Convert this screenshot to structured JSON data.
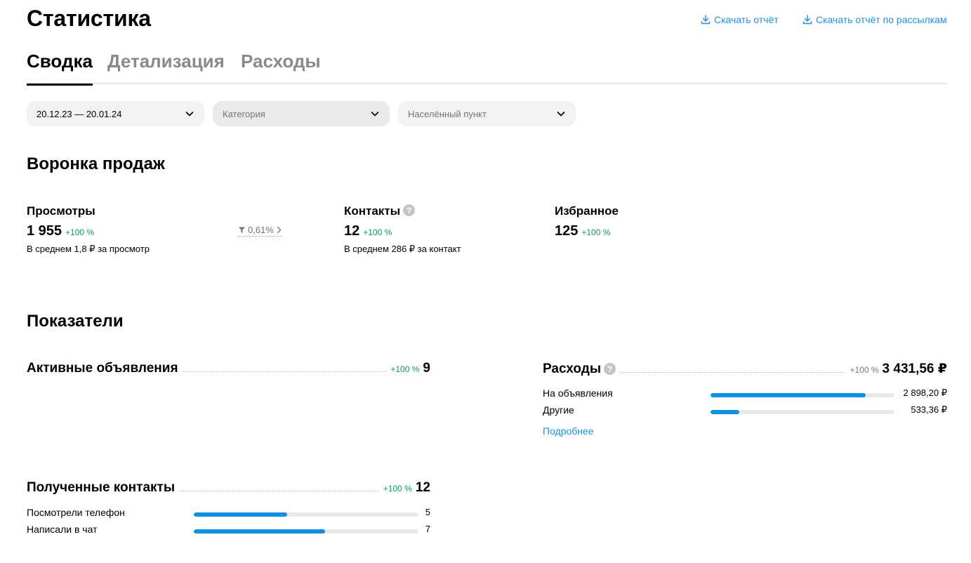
{
  "header": {
    "title": "Статистика",
    "download_report": "Скачать отчёт",
    "download_mailing_report": "Скачать отчёт по рассылкам"
  },
  "tabs": [
    {
      "label": "Сводка",
      "active": true
    },
    {
      "label": "Детализация",
      "active": false
    },
    {
      "label": "Расходы",
      "active": false
    }
  ],
  "filters": {
    "period": "20.12.23 — 20.01.24",
    "category_placeholder": "Категория",
    "location_placeholder": "Населённый пункт"
  },
  "funnel": {
    "title": "Воронка продаж",
    "views": {
      "label": "Просмотры",
      "value": "1 955",
      "delta": "+100 %",
      "sub": "В среднем 1,8 ₽ за просмотр"
    },
    "conversion": "0,61%",
    "contacts": {
      "label": "Контакты",
      "value": "12",
      "delta": "+100 %",
      "sub": "В среднем 286 ₽ за контакт"
    },
    "favorites": {
      "label": "Избранное",
      "value": "125",
      "delta": "+100 %"
    }
  },
  "indicators": {
    "title": "Показатели",
    "active_ads": {
      "label": "Активные объявления",
      "delta": "+100 %",
      "value": "9"
    },
    "expenses": {
      "label": "Расходы",
      "delta": "+100 %",
      "value": "3 431,56 ₽",
      "rows": [
        {
          "label": "На объявления",
          "value": "2 898,20 ₽",
          "fraction": 0.845
        },
        {
          "label": "Другие",
          "value": "533,36 ₽",
          "fraction": 0.155
        }
      ],
      "more_link": "Подробнее"
    },
    "contacts_received": {
      "label": "Полученные контакты",
      "delta": "+100 %",
      "value": "12",
      "rows": [
        {
          "label": "Посмотрели телефон",
          "value": "5",
          "fraction": 0.4167
        },
        {
          "label": "Написали в чат",
          "value": "7",
          "fraction": 0.5833
        }
      ]
    }
  },
  "colors": {
    "accent": "#1a91e6",
    "bar": "#0b91ec",
    "positive": "#02a05d"
  }
}
